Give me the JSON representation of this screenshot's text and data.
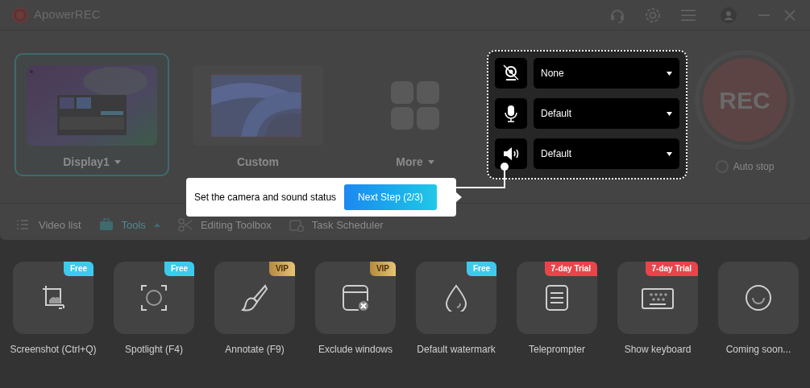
{
  "window": {
    "title": "ApowerREC"
  },
  "sources": [
    {
      "label": "Display1",
      "selected": true,
      "has_caret": true,
      "kind": "display"
    },
    {
      "label": "Custom",
      "selected": false,
      "has_caret": false,
      "kind": "region"
    },
    {
      "label": "More",
      "selected": false,
      "has_caret": true,
      "kind": "grid"
    }
  ],
  "devices": [
    {
      "kind": "camera",
      "value": "None"
    },
    {
      "kind": "microphone",
      "value": "Default"
    },
    {
      "kind": "speaker",
      "value": "Default"
    }
  ],
  "rec_button": {
    "label": "REC"
  },
  "auto_stop": {
    "label": "Auto stop",
    "checked": false
  },
  "nav": [
    {
      "label": "Video list",
      "kind": "list",
      "selected": false
    },
    {
      "label": "Tools",
      "kind": "tools",
      "selected": true,
      "expanded": true
    },
    {
      "label": "Editing Toolbox",
      "kind": "scissors",
      "selected": false
    },
    {
      "label": "Task Scheduler",
      "kind": "schedule",
      "selected": false
    }
  ],
  "tooltip": {
    "text": "Set the camera and sound status",
    "button": "Next Step (2/3)"
  },
  "tools": [
    {
      "label": "Screenshot (Ctrl+Q)",
      "badge": {
        "label": "Free",
        "kind": "free"
      }
    },
    {
      "label": "Spotlight (F4)",
      "badge": {
        "label": "Free",
        "kind": "free"
      }
    },
    {
      "label": "Annotate (F9)",
      "badge": {
        "label": "VIP",
        "kind": "vip"
      }
    },
    {
      "label": "Exclude windows",
      "badge": {
        "label": "VIP",
        "kind": "vip"
      }
    },
    {
      "label": "Default watermark",
      "badge": {
        "label": "Free",
        "kind": "free"
      }
    },
    {
      "label": "Teleprompter",
      "badge": {
        "label": "7-day Trial",
        "kind": "trial"
      }
    },
    {
      "label": "Show keyboard",
      "badge": {
        "label": "7-day Trial",
        "kind": "trial"
      }
    },
    {
      "label": "Coming soon..."
    }
  ]
}
